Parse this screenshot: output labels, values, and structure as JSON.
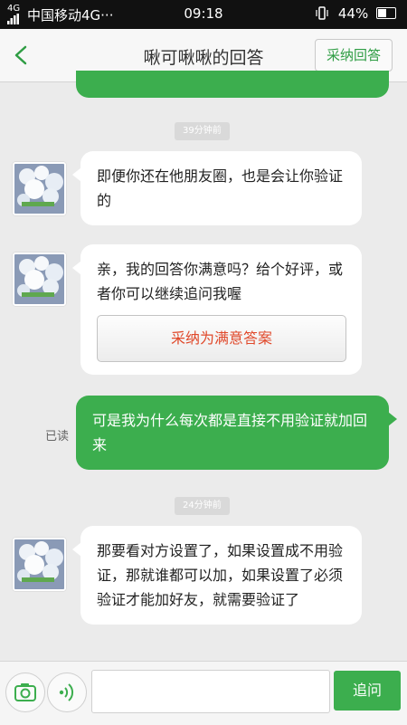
{
  "status": {
    "network": "4G",
    "carrier": "中国移动4G···",
    "time": "09:18",
    "battery": "44%"
  },
  "header": {
    "back_icon": "chevron-left-icon",
    "title": "啾可啾啾的回答",
    "adopt_label": "采纳回答"
  },
  "messages": {
    "ts1": "39分钟前",
    "m1": "即便你还在他朋友圈，也是会让你验证的",
    "m2": "亲，我的回答你满意吗？给个好评，或者你可以继续追问我喔",
    "m2_button": "采纳为满意答案",
    "m3": "可是我为什么每次都是直接不用验证就加回来",
    "m3_status": "已读",
    "ts2": "24分钟前",
    "m4": "那要看对方设置了，如果设置成不用验证，那就谁都可以加，如果设置了必须验证才能加好友，就需要验证了"
  },
  "input_bar": {
    "camera_icon": "camera-icon",
    "voice_icon": "voice-icon",
    "placeholder": "",
    "send_label": "追问"
  },
  "colors": {
    "accent": "#3cae4e",
    "adopt_text": "#e0492b"
  }
}
